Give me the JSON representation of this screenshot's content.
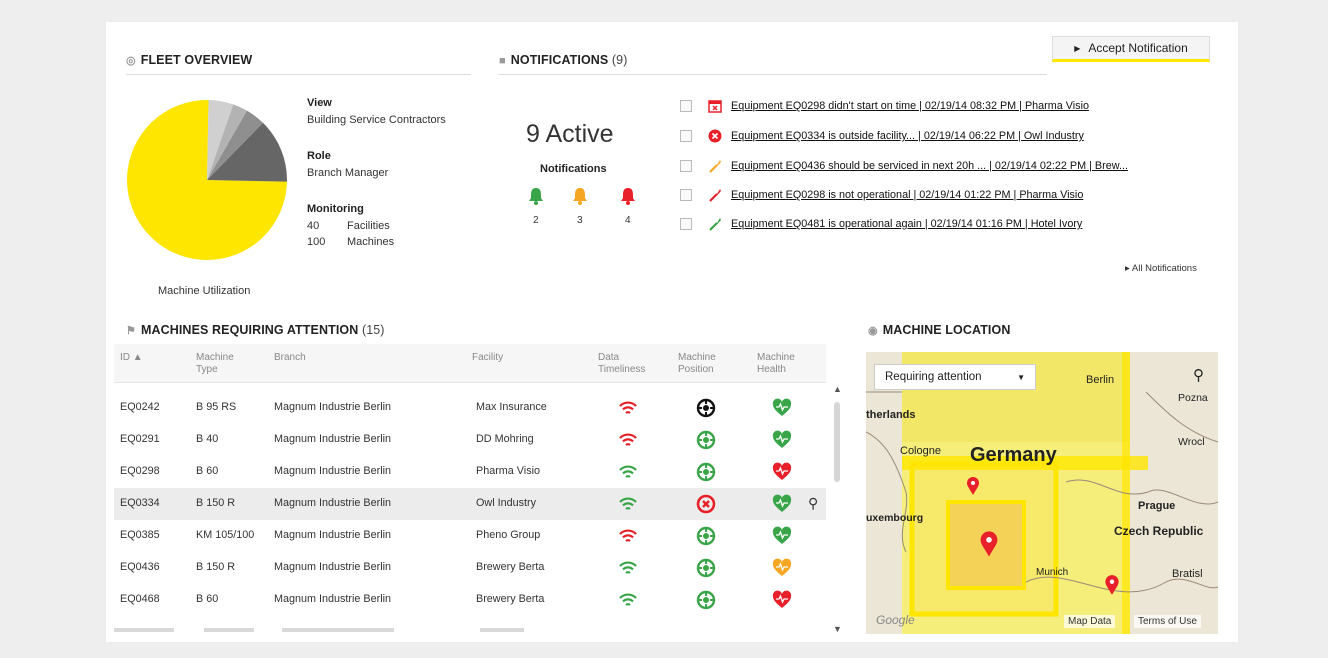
{
  "fleet": {
    "title": "FLEET OVERVIEW",
    "view_label": "View",
    "view_value": "Building Service Contractors",
    "role_label": "Role",
    "role_value": "Branch Manager",
    "monitoring_label": "Monitoring",
    "facilities_count": "40",
    "facilities_label": "Facilities",
    "machines_count": "100",
    "machines_label": "Machines",
    "pie_caption": "Machine Utilization",
    "pie_slices": [
      {
        "value": 0.75,
        "color": "#ffe600"
      },
      {
        "value": 0.13,
        "color": "#666666"
      },
      {
        "value": 0.04,
        "color": "#8f8f8f"
      },
      {
        "value": 0.03,
        "color": "#b3b3b3"
      },
      {
        "value": 0.05,
        "color": "#d0d0d0"
      }
    ]
  },
  "notifications": {
    "title": "NOTIFICATIONS",
    "count": "(9)",
    "active_text": "9 Active",
    "sub_label": "Notifications",
    "bells": [
      {
        "color": "#3aa548",
        "count": "2"
      },
      {
        "color": "#f5a623",
        "count": "3"
      },
      {
        "color": "#e8202a",
        "count": "4"
      }
    ],
    "accept_button": "Accept Notification",
    "items": [
      {
        "icon": "calendar-error-icon",
        "color": "#e8202a",
        "text": "Equipment EQ0298 didn't start on time | 02/19/14 08:32 PM | Pharma Visio"
      },
      {
        "icon": "x-circle-icon",
        "color": "#e8202a",
        "text": "Equipment EQ0334 is outside facility... | 02/19/14 06:22 PM | Owl Industry"
      },
      {
        "icon": "wrench-icon",
        "color": "#f5a623",
        "text": "Equipment EQ0436 should be serviced in next 20h ... | 02/19/14 02:22 PM | Brew..."
      },
      {
        "icon": "wrench-icon",
        "color": "#e8202a",
        "text": "Equipment EQ0298 is not operational | 02/19/14 01:22 PM | Pharma Visio"
      },
      {
        "icon": "wrench-icon",
        "color": "#3aa548",
        "text": "Equipment EQ0481 is operational again | 02/19/14 01:16 PM | Hotel Ivory"
      }
    ],
    "all_link": "All Notifications"
  },
  "machines": {
    "title": "MACHINES REQUIRING ATTENTION",
    "count": "(15)",
    "headers": {
      "id": "ID",
      "type": "Machine Type",
      "branch": "Branch",
      "facility": "Facility",
      "data": "Data Timeliness",
      "position": "Machine Position",
      "health": "Machine Health"
    },
    "rows": [
      {
        "id": "EQ0242",
        "type": "B 95 RS",
        "branch": "Magnum Industrie Berlin",
        "facility": "Max Insurance",
        "wifi": "#e8202a",
        "pos": "#111111",
        "health": "#3aa548"
      },
      {
        "id": "EQ0291",
        "type": "B 40",
        "branch": "Magnum Industrie Berlin",
        "facility": "DD Mohring",
        "wifi": "#e8202a",
        "pos": "#3aa548",
        "health": "#3aa548"
      },
      {
        "id": "EQ0298",
        "type": "B 60",
        "branch": "Magnum Industrie Berlin",
        "facility": "Pharma Visio",
        "wifi": "#3aa548",
        "pos": "#3aa548",
        "health": "#e8202a"
      },
      {
        "id": "EQ0334",
        "type": "B 150 R",
        "branch": "Magnum Industrie Berlin",
        "facility": "Owl Industry",
        "wifi": "#3aa548",
        "pos": "#e8202a",
        "health": "#3aa548"
      },
      {
        "id": "EQ0385",
        "type": "KM 105/100",
        "branch": "Magnum Industrie Berlin",
        "facility": "Pheno Group",
        "wifi": "#e8202a",
        "pos": "#3aa548",
        "health": "#3aa548"
      },
      {
        "id": "EQ0436",
        "type": "B 150 R",
        "branch": "Magnum Industrie Berlin",
        "facility": "Brewery Berta",
        "wifi": "#3aa548",
        "pos": "#3aa548",
        "health": "#f5a623"
      },
      {
        "id": "EQ0468",
        "type": "B 60",
        "branch": "Magnum Industrie Berlin",
        "facility": "Brewery Berta",
        "wifi": "#3aa548",
        "pos": "#3aa548",
        "health": "#e8202a"
      }
    ]
  },
  "map": {
    "title": "MACHINE LOCATION",
    "filter": "Requiring attention",
    "labels": [
      "Berlin",
      "Pozna",
      "Wrocl",
      "Germany",
      "Cologne",
      "therlands",
      "Prague",
      "Czech Republic",
      "uxembourg",
      "Bratisl",
      "Munich"
    ],
    "footer_left": "Google",
    "map_data": "Map Data",
    "terms": "Terms of Use"
  }
}
